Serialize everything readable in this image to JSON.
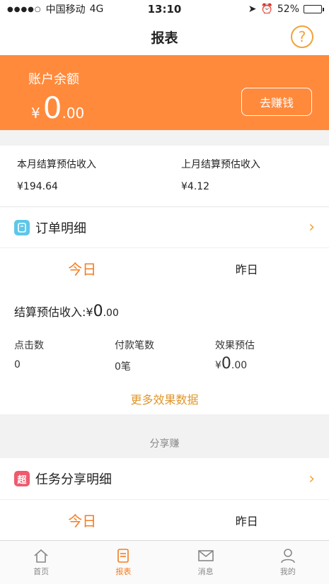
{
  "status_bar": {
    "carrier": "中国移动",
    "network": "4G",
    "time": "13:10",
    "battery_pct": "52%",
    "battery_level": 0.52
  },
  "nav": {
    "title": "报表",
    "help_glyph": "?"
  },
  "balance": {
    "label": "账户余额",
    "currency": "¥",
    "amount_int": "0",
    "amount_dec": ".00",
    "earn_button": "去赚钱"
  },
  "income": {
    "this_month_label": "本月结算预估收入",
    "this_month_value": "¥194.64",
    "last_month_label": "上月结算预估收入",
    "last_month_value": "¥4.12"
  },
  "order_detail": {
    "label": "订单明细",
    "icon": "order-icon"
  },
  "order_tabs": {
    "today": "今日",
    "yesterday": "昨日"
  },
  "order_stats": {
    "settle_label": "结算预估收入:",
    "settle_currency": "¥",
    "settle_int": "0",
    "settle_dec": ".00",
    "clicks_label": "点击数",
    "clicks_value": "0",
    "payments_label": "付款笔数",
    "payments_value": "0笔",
    "effect_label": "效果预估",
    "effect_currency": "¥",
    "effect_int": "0",
    "effect_dec": ".00",
    "more_link": "更多效果数据"
  },
  "share": {
    "header": "分享赚",
    "detail_label": "任务分享明细",
    "icon_glyph": "超"
  },
  "share_tabs": {
    "today": "今日",
    "yesterday": "昨日"
  },
  "tabbar": {
    "home": "首页",
    "report": "报表",
    "messages": "消息",
    "mine": "我的"
  },
  "colors": {
    "accent": "#ff8a3c",
    "active_tab": "#f57c1f",
    "link": "#e0962c"
  }
}
